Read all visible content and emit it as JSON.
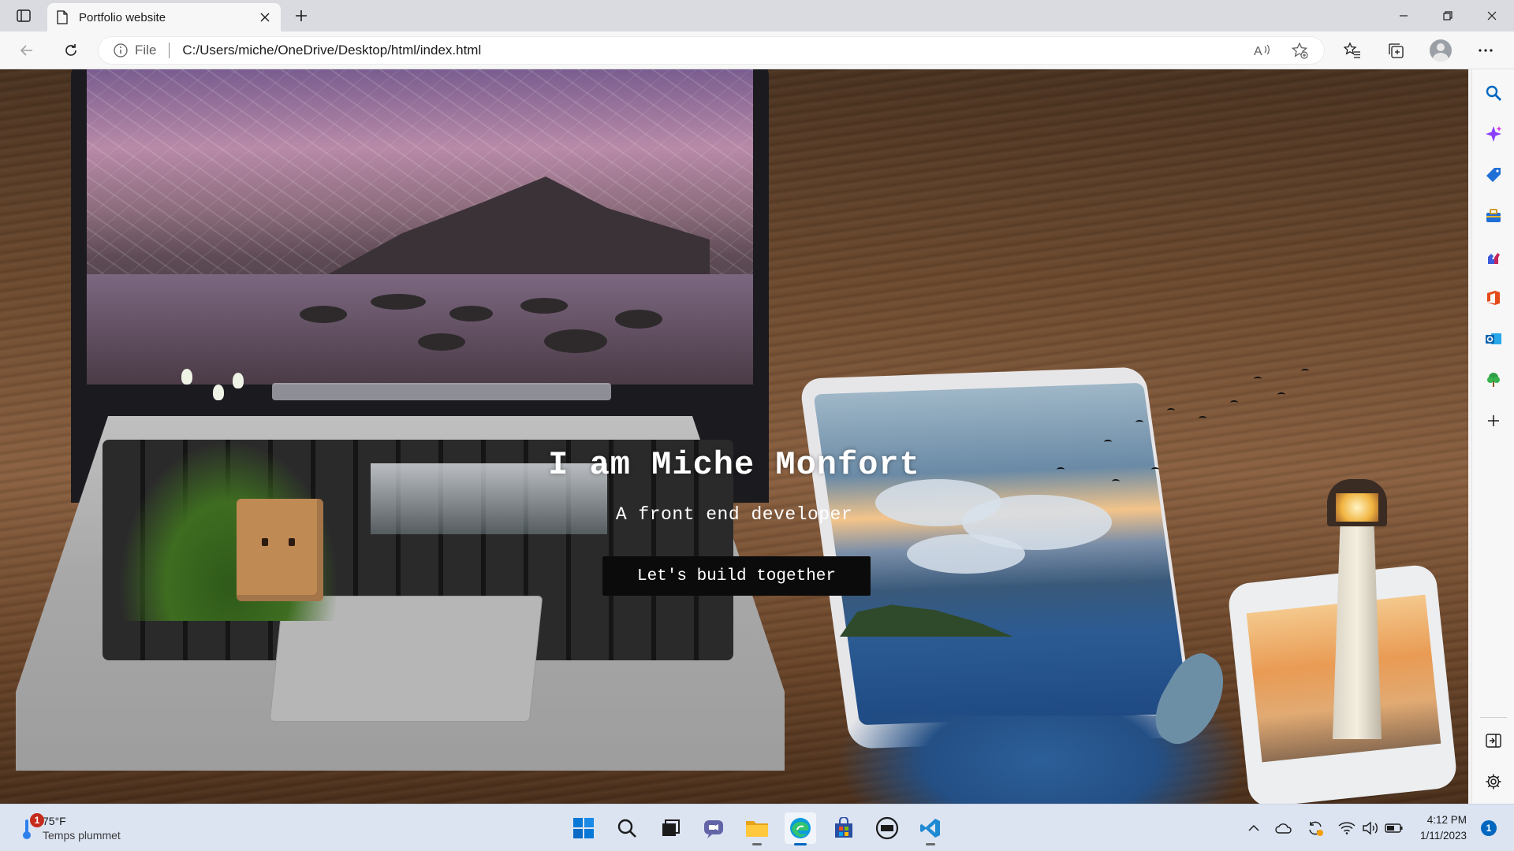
{
  "browser": {
    "tab": {
      "title": "Portfolio website",
      "icon": "page-icon"
    },
    "address": {
      "scheme": "File",
      "url": "C:/Users/miche/OneDrive/Desktop/html/index.html"
    },
    "accent": "#0067c0"
  },
  "page": {
    "hero_title": "I am Miche Monfort",
    "hero_subtitle": "A front end developer",
    "cta_label": "Let's build together"
  },
  "sidebar": {
    "items": [
      "search-icon",
      "copilot-icon",
      "shopping-icon",
      "tools-icon",
      "games-icon",
      "office-icon",
      "outlook-icon",
      "tree-icon",
      "add-icon"
    ],
    "bottom": [
      "split-screen-icon",
      "settings-icon"
    ]
  },
  "taskbar": {
    "weather": {
      "badge": "1",
      "temp": "75°F",
      "condition": "Temps plummet"
    },
    "apps": [
      "start",
      "search",
      "task-view",
      "chat",
      "file-explorer",
      "edge",
      "store",
      "dell",
      "vscode"
    ],
    "clock": {
      "time": "4:12 PM",
      "date": "1/11/2023"
    },
    "notifications": "1"
  }
}
